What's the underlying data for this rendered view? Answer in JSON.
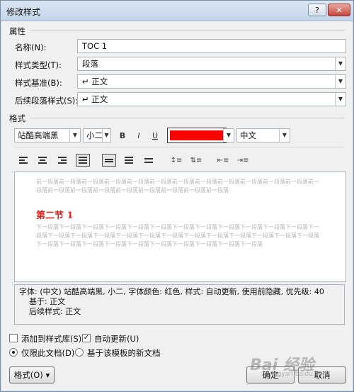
{
  "window": {
    "title": "修改样式",
    "help": "?",
    "close": "✕"
  },
  "properties": {
    "section": "属性",
    "name_label": "名称(N):",
    "name_value": "TOC 1",
    "type_label": "样式类型(T):",
    "type_value": "段落",
    "based_label": "样式基准(B):",
    "based_value": "↵ 正文",
    "next_label": "后续段落样式(S):",
    "next_value": "↵ 正文"
  },
  "format": {
    "section": "格式",
    "font": "站酷高端黑",
    "size": "小二",
    "bold": "B",
    "italic": "I",
    "underline": "U",
    "font_color": "#ff0000",
    "language": "中文"
  },
  "preview": {
    "prev_text": "前一段落前一段落前一段落前一段落前一段落前一段落前一段落前一段落前一段落前一段落前一段落前一段落前一段落前一段落前一段落前一段落前一段落前一段落前一段落前一段落前一段落",
    "heading": "第二节 1",
    "next_text": "下一段落下一段落下一段落下一段落下一段落下一段落下一段落下一段落下一段落下一段落下一段落下一段落下一段落下一段落下一段落下一段落下一段落下一段落下一段落下一段落下一段落下一段落下一段落下一段落下一段落下一段落下一段落下一段落下一段落下一段落下一段落下一段落下一段落下一段落下一段落"
  },
  "description": {
    "line1": "字体: (中文) 站酷高端黑, 小二, 字体颜色: 红色, 样式: 自动更新, 使用前隐藏, 优先级: 40",
    "line2": "基于: 正文",
    "line3": "后续样式: 正文"
  },
  "options": {
    "add_to_gallery": "添加到样式库(S)",
    "auto_update": "自动更新(U)",
    "this_doc_only": "仅限此文档(D)",
    "new_docs": "基于该模板的新文档"
  },
  "buttons": {
    "format": "格式(O) ▾",
    "ok": "确定",
    "cancel": "取消"
  },
  "watermark": {
    "logo": "Bai 经验",
    "url": "jingyan.baidu.com"
  }
}
